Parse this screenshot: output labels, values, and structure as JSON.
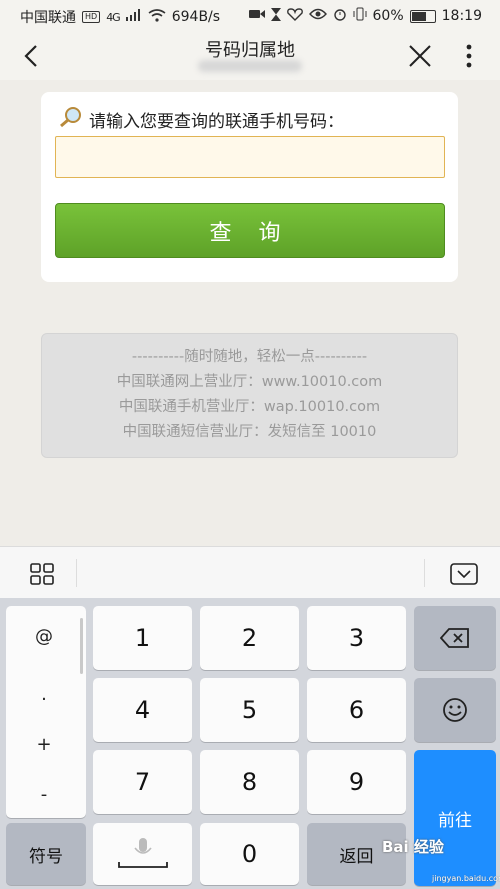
{
  "status_bar": {
    "carrier": "中国联通",
    "hd": "HD",
    "network": "4G",
    "speed": "694B/s",
    "battery": "60%",
    "time": "18:19"
  },
  "header": {
    "title": "号码归属地"
  },
  "query": {
    "prompt": "请输入您要查询的联通手机号码：",
    "input_value": "",
    "button_label": "查 询"
  },
  "info": {
    "line1": "----------随时随地，轻松一点----------",
    "line2": "中国联通网上营业厅：www.10010.com",
    "line3": "中国联通手机营业厅：wap.10010.com",
    "line4": "中国联通短信营业厅：发短信至 10010"
  },
  "keyboard": {
    "symbols": [
      "@",
      ".",
      "+",
      "-"
    ],
    "keys": [
      "1",
      "2",
      "3",
      "4",
      "5",
      "6",
      "7",
      "8",
      "9",
      "0"
    ],
    "symbol_key": "符号",
    "back_key": "返回",
    "go_key": "前往"
  },
  "watermark": {
    "text": "Bai 经验",
    "url": "jingyan.baidu.com"
  },
  "colors": {
    "query_button": "#6cb331",
    "go_key": "#1e8eff",
    "input_border": "#e1b454"
  }
}
